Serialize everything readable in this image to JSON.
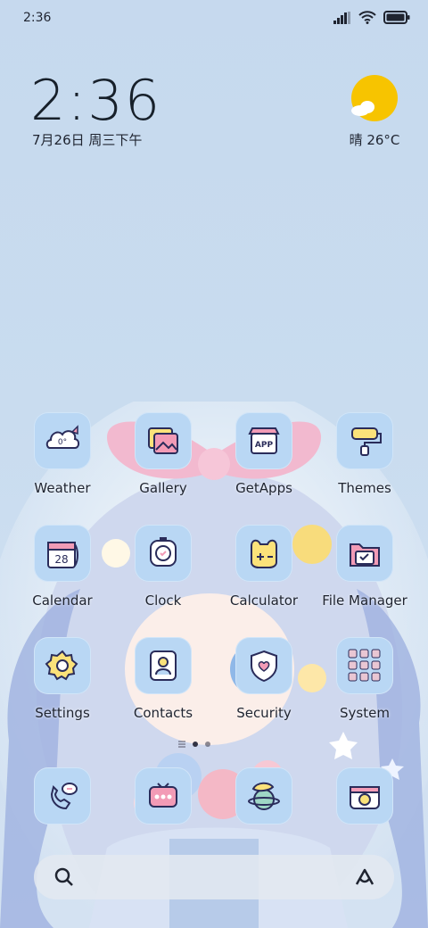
{
  "status_bar": {
    "time": "2:36"
  },
  "lock_widget": {
    "time": "2:36",
    "date": "7月26日 周三下午"
  },
  "weather_widget": {
    "text": "晴 26°C"
  },
  "apps": [
    {
      "label": "Weather",
      "icon": "weather-icon"
    },
    {
      "label": "Gallery",
      "icon": "gallery-icon"
    },
    {
      "label": "GetApps",
      "icon": "getapps-icon",
      "badge": "APP"
    },
    {
      "label": "Themes",
      "icon": "themes-icon"
    },
    {
      "label": "Calendar",
      "icon": "calendar-icon",
      "day": "28"
    },
    {
      "label": "Clock",
      "icon": "clock-icon"
    },
    {
      "label": "Calculator",
      "icon": "calculator-icon"
    },
    {
      "label": "File Manager",
      "icon": "file-manager-icon"
    },
    {
      "label": "Settings",
      "icon": "settings-icon"
    },
    {
      "label": "Contacts",
      "icon": "contacts-icon"
    },
    {
      "label": "Security",
      "icon": "security-icon"
    },
    {
      "label": "System",
      "icon": "system-folder-icon"
    }
  ],
  "weather_icon_text": "0°",
  "dock": [
    "phone-icon",
    "messages-icon",
    "browser-icon",
    "camera-icon"
  ],
  "colors": {
    "tile": "#b9d7f4",
    "text": "#1f2430",
    "sun": "#f7c400"
  }
}
